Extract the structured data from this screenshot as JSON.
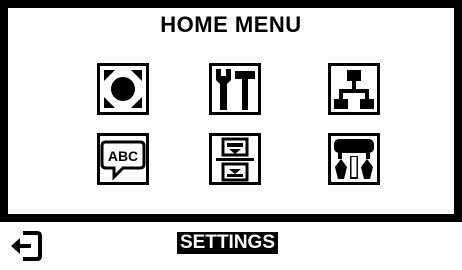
{
  "screen": {
    "title": "HOME MENU",
    "selected_label": "SETTINGS",
    "colors": {
      "foreground": "#000000",
      "background": "#ffffff"
    }
  },
  "menu": {
    "items": [
      {
        "icon": "settings-gear-icon",
        "selected": true
      },
      {
        "icon": "tools-wrench-hammer-icon",
        "selected": false
      },
      {
        "icon": "network-hierarchy-icon",
        "selected": false
      },
      {
        "icon": "language-abc-speech-bubble-icon",
        "selected": false
      },
      {
        "icon": "scroll-up-down-menu-icon",
        "selected": false
      },
      {
        "icon": "implement-drill-icon",
        "selected": false
      }
    ]
  },
  "footer": {
    "back_icon": "exit-back-arrow-icon"
  }
}
